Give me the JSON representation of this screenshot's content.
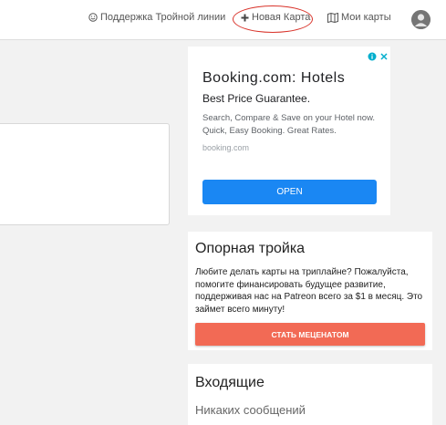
{
  "nav": {
    "support_label": "Поддержка Тройной линии",
    "new_map_label": "Новая Карта",
    "my_maps_label": "Мои карты"
  },
  "ad": {
    "title": "Booking.com: Hotels",
    "subtitle": "Best Price Guarantee.",
    "description": "Search, Compare & Save on your Hotel now. Quick, Easy Booking. Great Rates.",
    "domain": "booking.com",
    "button_label": "OPEN"
  },
  "patron": {
    "title": "Опорная тройка",
    "text": "Любите делать карты на триплайне? Пожалуйста, помогите финансировать будущее развитие, поддерживая нас на Patreon всего за $1 в месяц. Это займет всего минуту!",
    "button_label": "СТАТЬ МЕЦЕНАТОМ"
  },
  "inbox": {
    "title": "Входящие",
    "empty_text": "Никаких сообщений"
  },
  "colors": {
    "annotation_ellipse": "#d9342b",
    "ad_button": "#1a87f3",
    "patron_button": "#f26a55",
    "background": "#f2f2f2"
  },
  "icons": [
    "smiley-icon",
    "plus-icon",
    "map-icon",
    "user-avatar-icon",
    "ad-info-icon",
    "ad-close-icon"
  ]
}
